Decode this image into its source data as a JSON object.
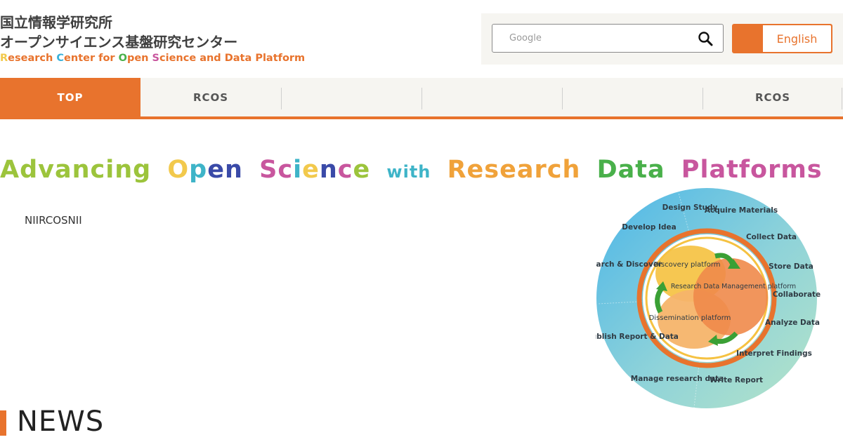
{
  "header": {
    "org_name_ja": "国立情報学研究所",
    "center_name_ja": "オープンサイエンス基盤研究センター",
    "center_name_en_parts": [
      "R",
      "esearch ",
      "C",
      "enter for ",
      "O",
      "pen ",
      "S",
      "cience and Data Platform"
    ]
  },
  "search": {
    "placeholder": "Google",
    "icon": "search-icon"
  },
  "language_button": {
    "label": "English"
  },
  "nav": {
    "items": [
      {
        "label": "TOP",
        "active": true
      },
      {
        "label": "RCOS",
        "active": false
      },
      {
        "label": "",
        "active": false
      },
      {
        "label": "",
        "active": false
      },
      {
        "label": "",
        "active": false
      },
      {
        "label": "RCOS",
        "active": false
      }
    ]
  },
  "hero": {
    "tagline": {
      "w1": "Advancing",
      "w2a": "O",
      "w2b": "p",
      "w2c": "e",
      "w2d": "n",
      "w3a": "S",
      "w3b": "c",
      "w3c": "i",
      "w3d": "e",
      "w3e": "n",
      "w3f": "c",
      "w3g": "e",
      "w4": "with",
      "w5": "Research",
      "w6": "Data",
      "w7": "Platforms"
    },
    "intro": "NIIRCOSNII"
  },
  "diagram": {
    "outer_labels": [
      "Design Study",
      "Acquire Materials",
      "Collect Data",
      "Store Data",
      "Collaborate",
      "Analyze Data",
      "Interpret Findings",
      "Write Report",
      "Manage research data",
      "Publish Report & Data",
      "Search & Discover",
      "Develop Idea"
    ],
    "platforms": {
      "discovery": "Discovery platform",
      "rdm": "Research Data Management platform",
      "dissemination": "Dissemination platform"
    },
    "colors": {
      "ring_blue": "#5bbfe6",
      "ring_teal": "#9fdacb",
      "accent_orange": "#e8732d",
      "discovery_yellow": "#f5c242",
      "rdm_orange": "#ef8a4a",
      "dissemination_peach": "#f5b46a",
      "arrow_green": "#3aa035"
    }
  },
  "news": {
    "title": "NEWS"
  },
  "colors": {
    "accent": "#e8732d",
    "nav_bg": "#f6f5f1",
    "text_dark": "#3f3f3f"
  }
}
